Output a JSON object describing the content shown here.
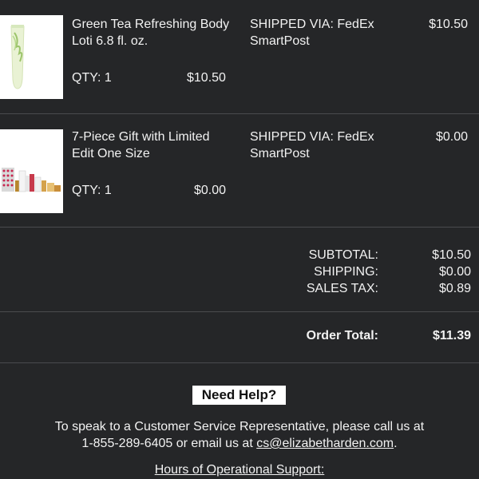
{
  "items": [
    {
      "name_line1": "Green Tea Refreshing Body",
      "name_line2": "Loti 6.8 fl. oz.",
      "shipping_line1": "SHIPPED VIA: FedEx",
      "shipping_line2": "SmartPost",
      "price": "$10.50",
      "qty_label": "QTY: 1",
      "qty_price": "$10.50",
      "image_icon": "green-tea-lotion-tube"
    },
    {
      "name_line1": "7-Piece Gift with Limited",
      "name_line2": "Edit One Size",
      "shipping_line1": "SHIPPED VIA: FedEx",
      "shipping_line2": "SmartPost",
      "price": "$0.00",
      "qty_label": "QTY: 1",
      "qty_price": "$0.00",
      "image_icon": "gift-set-collection"
    }
  ],
  "totals": {
    "subtotal_label": "SUBTOTAL:",
    "subtotal_value": "$10.50",
    "shipping_label": "SHIPPING:",
    "shipping_value": "$0.00",
    "tax_label": "SALES TAX:",
    "tax_value": "$0.89",
    "order_total_label": "Order Total:",
    "order_total_value": "$11.39"
  },
  "help": {
    "title": "Need Help?",
    "line1": "To speak to a Customer Service Representative, please call us at",
    "line2_prefix": "1-855-289-6405 or email us at ",
    "email": "cs@elizabetharden.com",
    "line2_suffix": ".",
    "hours_link": "Hours of Operational Support:"
  },
  "colors": {
    "background": "#252628",
    "divider": "#4a4b4e",
    "text": "#f2f2f2"
  }
}
